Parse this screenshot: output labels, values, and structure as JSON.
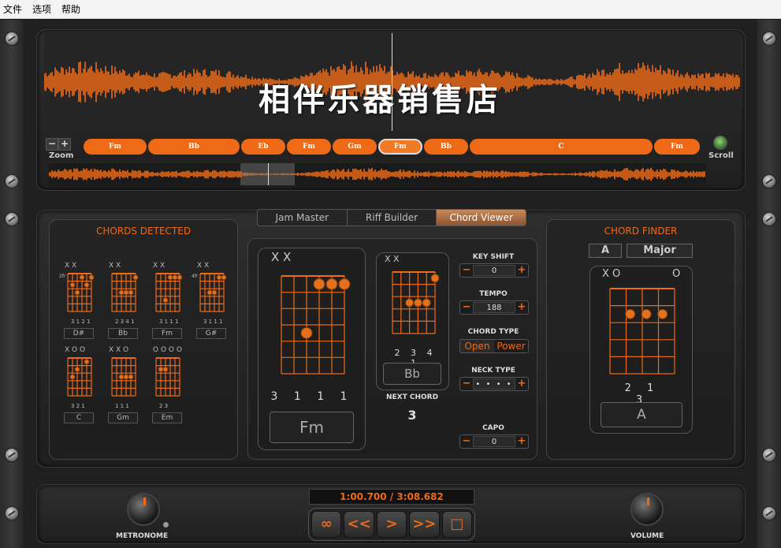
{
  "menu": [
    "文件",
    "选项",
    "帮助"
  ],
  "watermark": "相伴乐器销售店",
  "zoom": {
    "minus": "−",
    "plus": "+",
    "label": "Zoom"
  },
  "scroll_label": "Scroll",
  "timeline_chords": [
    "Fm",
    "Bb",
    "Eb",
    "Fm",
    "Gm",
    "Fm",
    "Bb",
    "C",
    "Fm"
  ],
  "tabs": [
    "Jam Master",
    "Riff Builder",
    "Chord Viewer"
  ],
  "active_tab": "Chord Viewer",
  "chords_detected": {
    "title": "CHORDS DETECTED",
    "items": [
      {
        "name": "D#",
        "top": "X X",
        "fret": "2fr",
        "fingers": "3 1 2 1"
      },
      {
        "name": "Bb",
        "top": "X X",
        "fret": "",
        "fingers": "2 3 4 1"
      },
      {
        "name": "Fm",
        "top": "X X",
        "fret": "",
        "fingers": "3 1 1 1"
      },
      {
        "name": "G#",
        "top": "X X",
        "fret": "4fr",
        "fingers": "3 1 1 1"
      },
      {
        "name": "C",
        "top": "X   O  O",
        "fret": "",
        "fingers": "3 2   1"
      },
      {
        "name": "Gm",
        "top": "X X O",
        "fret": "",
        "fingers": "1 1 1"
      },
      {
        "name": "Em",
        "top": "O   O O O",
        "fret": "",
        "fingers": "2 3"
      }
    ]
  },
  "current_chord": {
    "top": "X X",
    "fingers": "3 1 1 1",
    "name": "Fm"
  },
  "next_chord": {
    "top": "X X",
    "fingers": "2 3 4 1",
    "name": "Bb",
    "label": "NEXT CHORD",
    "countdown": "3"
  },
  "controls": {
    "key_shift": {
      "label": "KEY SHIFT",
      "value": "0"
    },
    "tempo": {
      "label": "TEMPO",
      "value": "188"
    },
    "chord_type": {
      "label": "CHORD TYPE",
      "options": [
        "Open",
        "Power"
      ]
    },
    "neck_type": {
      "label": "NECK TYPE",
      "value": "• • • •"
    },
    "capo": {
      "label": "CAPO",
      "value": "0"
    }
  },
  "chord_finder": {
    "title": "CHORD FINDER",
    "root": "A",
    "quality": "Major",
    "top_left": "X O",
    "top_right": "O",
    "fingers": "2 1 3",
    "name": "A"
  },
  "transport": {
    "time": "1:00.700 / 3:08.682",
    "buttons": [
      "∞",
      "<<",
      ">",
      ">>",
      "□"
    ]
  },
  "metronome_label": "METRONOME",
  "volume_label": "VOLUME",
  "colors": {
    "accent": "#ef6a16",
    "background": "#1a1a1a"
  }
}
